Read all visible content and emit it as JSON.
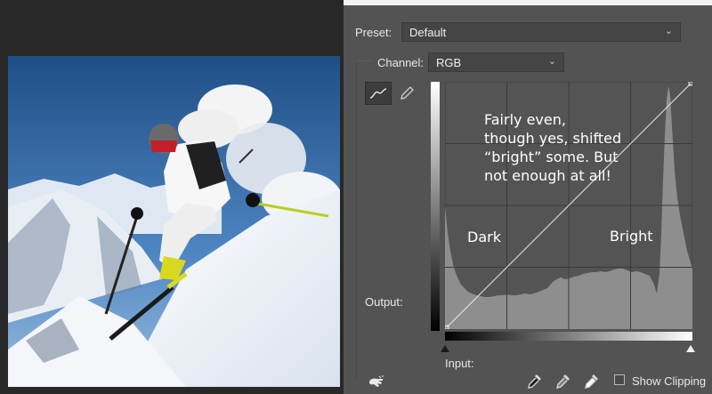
{
  "panel": {
    "preset_label": "Preset:",
    "preset_value": "Default",
    "channel_label": "Channel:",
    "channel_value": "RGB",
    "output_label": "Output:",
    "input_label": "Input:",
    "show_clipping_label": "Show Clipping",
    "show_clipping_checked": false
  },
  "tools": {
    "curve_tool_icon": "curve-icon",
    "pencil_tool_icon": "pencil-icon",
    "on_image_icon": "hand-target-icon",
    "eyedroppers": [
      "black-eyedropper-icon",
      "gray-eyedropper-icon",
      "white-eyedropper-icon"
    ]
  },
  "annotations": {
    "main": [
      "Fairly even,",
      "though yes, shifted",
      "“bright” some. But",
      "not enough at all!"
    ],
    "dark": "Dark",
    "bright": "Bright"
  },
  "colors": {
    "panel_bg": "#535353",
    "graph_bg": "#545454",
    "histogram": "#8e8e8e",
    "canvas_bg": "#282828"
  },
  "image": {
    "subject": "skier descending snowy mountain slope"
  }
}
